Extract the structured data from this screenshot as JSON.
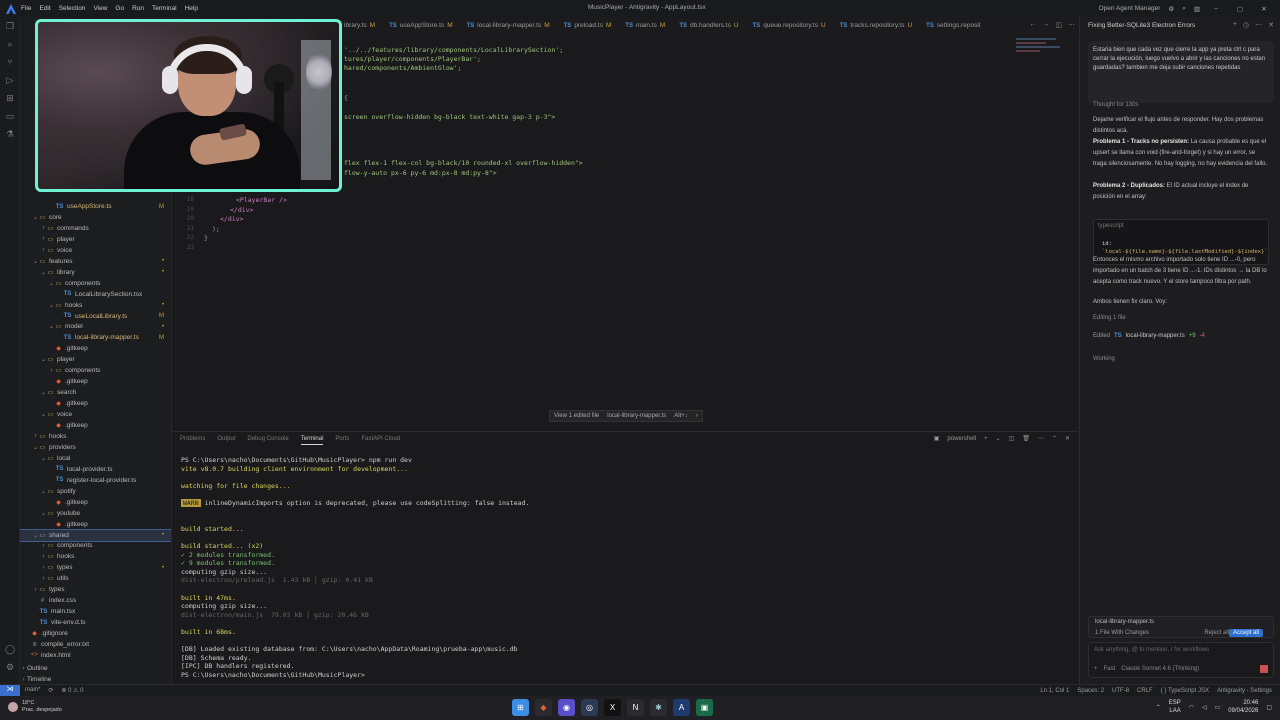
{
  "window": {
    "title": "MusicPlayer - Antigravity - AppLayout.tsx",
    "menu": [
      "File",
      "Edit",
      "Selection",
      "View",
      "Go",
      "Run",
      "Terminal",
      "Help"
    ],
    "agent_manager": "Open Agent Manager"
  },
  "tabs": [
    {
      "label": "ibrary.ts",
      "mark": "M"
    },
    {
      "label": "useAppStore.ts",
      "mark": "M"
    },
    {
      "label": "local-library-mapper.ts",
      "mark": "M"
    },
    {
      "label": "preload.ts",
      "mark": "M"
    },
    {
      "label": "main.ts",
      "mark": "M"
    },
    {
      "label": "db.handlers.ts",
      "mark": "U"
    },
    {
      "label": "queue.repository.ts",
      "mark": "U"
    },
    {
      "label": "tracks.repository.ts",
      "mark": "U"
    },
    {
      "label": "settings.reposit",
      "mark": ""
    }
  ],
  "explorer": [
    {
      "label": "useAppStore.ts",
      "depth": 3,
      "kind": "ts",
      "badge": "M"
    },
    {
      "label": "core",
      "depth": 1,
      "kind": "folder-open"
    },
    {
      "label": "commands",
      "depth": 2,
      "kind": "folder"
    },
    {
      "label": "player",
      "depth": 2,
      "kind": "folder"
    },
    {
      "label": "voice",
      "depth": 2,
      "kind": "folder"
    },
    {
      "label": "features",
      "depth": 1,
      "kind": "folder-open",
      "badge": "•"
    },
    {
      "label": "library",
      "depth": 2,
      "kind": "folder-open",
      "badge": "•"
    },
    {
      "label": "components",
      "depth": 3,
      "kind": "folder-open"
    },
    {
      "label": "LocalLibrarySection.tsx",
      "depth": 4,
      "kind": "tsx"
    },
    {
      "label": "hooks",
      "depth": 3,
      "kind": "folder-open",
      "badge": "•"
    },
    {
      "label": "useLocalLibrary.ts",
      "depth": 4,
      "kind": "ts",
      "badge": "M"
    },
    {
      "label": "model",
      "depth": 3,
      "kind": "folder-open",
      "badge": "•"
    },
    {
      "label": "local-library-mapper.ts",
      "depth": 4,
      "kind": "ts",
      "badge": "M"
    },
    {
      "label": ".gitkeep",
      "depth": 3,
      "kind": "git"
    },
    {
      "label": "player",
      "depth": 2,
      "kind": "folder-open"
    },
    {
      "label": "components",
      "depth": 3,
      "kind": "folder"
    },
    {
      "label": ".gitkeep",
      "depth": 3,
      "kind": "git"
    },
    {
      "label": "search",
      "depth": 2,
      "kind": "folder-open"
    },
    {
      "label": ".gitkeep",
      "depth": 3,
      "kind": "git"
    },
    {
      "label": "voice",
      "depth": 2,
      "kind": "folder-open"
    },
    {
      "label": ".gitkeep",
      "depth": 3,
      "kind": "git"
    },
    {
      "label": "hooks",
      "depth": 1,
      "kind": "folder"
    },
    {
      "label": "providers",
      "depth": 1,
      "kind": "folder-open"
    },
    {
      "label": "local",
      "depth": 2,
      "kind": "folder-open"
    },
    {
      "label": "local-provider.ts",
      "depth": 3,
      "kind": "ts"
    },
    {
      "label": "register-local-provider.ts",
      "depth": 3,
      "kind": "ts"
    },
    {
      "label": "spotify",
      "depth": 2,
      "kind": "folder-open"
    },
    {
      "label": ".gitkeep",
      "depth": 3,
      "kind": "git"
    },
    {
      "label": "youtube",
      "depth": 2,
      "kind": "folder-open"
    },
    {
      "label": ".gitkeep",
      "depth": 3,
      "kind": "git"
    },
    {
      "label": "shared",
      "depth": 1,
      "kind": "folder-open",
      "badge": "•",
      "selected": true
    },
    {
      "label": "components",
      "depth": 2,
      "kind": "folder"
    },
    {
      "label": "hooks",
      "depth": 2,
      "kind": "folder"
    },
    {
      "label": "types",
      "depth": 2,
      "kind": "folder",
      "badge": "•"
    },
    {
      "label": "utils",
      "depth": 2,
      "kind": "folder"
    },
    {
      "label": "types",
      "depth": 1,
      "kind": "folder"
    },
    {
      "label": "index.css",
      "depth": 1,
      "kind": "css"
    },
    {
      "label": "main.tsx",
      "depth": 1,
      "kind": "tsx"
    },
    {
      "label": "vite-env.d.ts",
      "depth": 1,
      "kind": "ts"
    },
    {
      "label": ".gitignore",
      "depth": 0,
      "kind": "git"
    },
    {
      "label": "compile_error.txt",
      "depth": 0,
      "kind": "txt"
    },
    {
      "label": "index.html",
      "depth": 0,
      "kind": "html"
    }
  ],
  "explorer_sections": {
    "outline": "Outline",
    "timeline": "Timeline"
  },
  "editor": {
    "lines": [
      {
        "text": "'../../features/library/components/LocalLibrarySection';",
        "cls": ""
      },
      {
        "text": "tures/player/components/PlayerBar';",
        "cls": ""
      },
      {
        "text": "hared/components/AmbientGlow';",
        "cls": ""
      },
      {
        "text": "{",
        "cls": "k"
      },
      {
        "text": "screen overflow-hidden bg-black text-white gap-3 p-3\">",
        "cls": ""
      },
      {
        "text": "flex flex-1 flex-col bg-black/10 rounded-xl overflow-hidden\">",
        "cls": ""
      },
      {
        "text": "flow-y-auto px-6 py-6 md:px-8 md:py-8\">",
        "cls": ""
      }
    ],
    "numbered": [
      {
        "n": "18",
        "text": "<PlayerBar />",
        "cls": "t"
      },
      {
        "n": "19",
        "text": "</div>",
        "cls": "t"
      },
      {
        "n": "20",
        "text": "</div>",
        "cls": "t"
      },
      {
        "n": "21",
        "text": ");",
        "cls": "k"
      },
      {
        "n": "22",
        "text": "}",
        "cls": "k"
      },
      {
        "n": "23",
        "text": "",
        "cls": "k"
      }
    ],
    "viewbar": {
      "left": "View 1 edited file",
      "file": "local-library-mapper.ts",
      "shortcut": "Alt+↓"
    }
  },
  "panel": {
    "tabs": [
      "Problems",
      "Output",
      "Debug Console",
      "Terminal",
      "Ports",
      "FastAPI Cloud"
    ],
    "active_tab": "Terminal",
    "shell": "powershell",
    "terminal": [
      {
        "text": "PS C:\\Users\\nacho\\Documents\\GitHub\\MusicPlayer> npm run dev",
        "cls": ""
      },
      {
        "text": "vite v8.0.7 building client environment for development...",
        "cls": "y"
      },
      {
        "text": "",
        "cls": ""
      },
      {
        "text": "watching for file changes...",
        "cls": "y"
      },
      {
        "text": "",
        "cls": ""
      },
      {
        "text": "WARN",
        "cls": "warn",
        "rest": " inlineDynamicImports option is deprecated, please use codeSplitting: false instead."
      },
      {
        "text": "",
        "cls": ""
      },
      {
        "text": "",
        "cls": ""
      },
      {
        "text": "build started...",
        "cls": "y"
      },
      {
        "text": "",
        "cls": ""
      },
      {
        "text": "build started... (x2)",
        "cls": "y"
      },
      {
        "text": "✓ 2 modules transformed.",
        "cls": "g"
      },
      {
        "text": "✓ 9 modules transformed.",
        "cls": "g"
      },
      {
        "text": "computing gzip size...",
        "cls": ""
      },
      {
        "text": "dist-electron/preload.js  1.43 kB │ gzip: 0.41 kB",
        "cls": "dim"
      },
      {
        "text": "",
        "cls": ""
      },
      {
        "text": "built in 47ms.",
        "cls": "y"
      },
      {
        "text": "computing gzip size...",
        "cls": ""
      },
      {
        "text": "dist-electron/main.js  79.03 kB │ gzip: 20.46 kB",
        "cls": "dim"
      },
      {
        "text": "",
        "cls": ""
      },
      {
        "text": "built in 68ms.",
        "cls": "y"
      },
      {
        "text": "",
        "cls": ""
      },
      {
        "text": "[DB] Loaded existing database from: C:\\Users\\nacho\\AppData\\Roaming\\prueba-app\\music.db",
        "cls": ""
      },
      {
        "text": "[DB] Schema ready.",
        "cls": ""
      },
      {
        "text": "[IPC] DB handlers registered.",
        "cls": ""
      },
      {
        "text": "PS C:\\Users\\nacho\\Documents\\GitHub\\MusicPlayer> ",
        "cls": ""
      }
    ]
  },
  "agent": {
    "title": "Fixing Better-SQLite3 Electron Errors",
    "user_message": "Estaria bien que cada vez que cierre la app ya preta ctrl c para cerrar la ejecución, luego vuelvo a abrir y las canciones no estan guardadas? tambien me deja subir canciones repetidas",
    "thought": "Thought for 130s",
    "para1": "Dejame verificar el flujo antes de responder. Hay dos problemas distintos acá.",
    "p1_title": "Problema 1 - Tracks no persisten:",
    "p1_body": " La causa probable es que el upsert se llama con void (fire-and-forget) y si hay un error, se traga silenciosamente. No hay logging, no hay evidencia del fallo.",
    "p2_title": "Problema 2 - Duplicados:",
    "p2_body": " El ID actual incluye el index de posición en el array:",
    "code_lang": "typescript",
    "code1": "id:",
    "code2": "`local-${file.name}-${file.lastModified}-${index}`",
    "para3": "Entonces el mismo archivo importado solo tiene ID ...-0, pero importado en un batch de 3 tiene ID ...-1. IDs distintos → la DB lo acepta como track nuevo. Y el store tampoco filtra por path.",
    "para4": "Ambos tienen fix claro. Voy:",
    "editing": "Editing 1 file",
    "edited_label": "Edited",
    "edited_file": "local-library-mapper.ts",
    "edited_plus": "+9",
    "edited_minus": "-4",
    "working": "Working",
    "changes_file": "local-library-mapper.ts",
    "changes_count": "1 File With Changes",
    "reject": "Reject all",
    "accept": "Accept all",
    "input_placeholder": "Ask anything, @ to mention, / for workflows",
    "model": "Claude Sonnet 4.6 (Thinking)",
    "mode": "Fast"
  },
  "statusbar": {
    "branch": "main*",
    "errors": "⊗ 0 ⚠ 0",
    "right": [
      "Ln 1, Col 1",
      "Spaces: 2",
      "UTF-8",
      "CRLF",
      "{ } TypeScript JSX",
      "Antigravity - Settings"
    ]
  },
  "taskbar": {
    "temp": "18°C",
    "weather": "Prac. despejado",
    "lang1": "ESP",
    "lang2": "LAA",
    "time": "20:46",
    "date": "09/04/2026"
  }
}
